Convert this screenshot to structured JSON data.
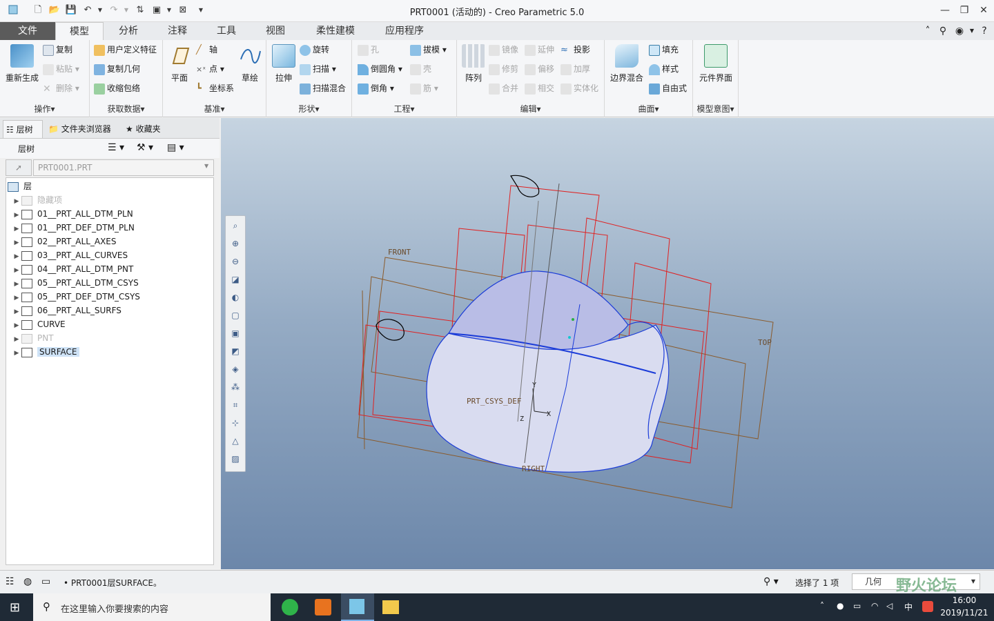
{
  "window": {
    "title": "PRT0001 (活动的) - Creo Parametric 5.0"
  },
  "tabs": [
    "文件",
    "模型",
    "分析",
    "注释",
    "工具",
    "视图",
    "柔性建模",
    "应用程序"
  ],
  "ribbon": {
    "operations": {
      "regen": "重新生成",
      "copy": "复制",
      "paste": "粘贴",
      "delete": "删除",
      "label": "操作▾"
    },
    "get_data": {
      "udf": "用户定义特征",
      "copy_geom": "复制几何",
      "shrinkwrap": "收缩包络",
      "label": "获取数据▾"
    },
    "datum": {
      "plane": "平面",
      "axis": "轴",
      "point": "点",
      "csys": "坐标系",
      "sketch": "草绘",
      "label": "基准▾"
    },
    "shapes": {
      "extrude": "拉伸",
      "revolve": "旋转",
      "sweep": "扫描",
      "swept_blend": "扫描混合",
      "label": "形状▾"
    },
    "engineering": {
      "hole": "孔",
      "round": "倒圆角",
      "chamfer": "倒角",
      "draft": "拔模",
      "shell": "壳",
      "rib": "筋",
      "label": "工程▾"
    },
    "editing": {
      "pattern": "阵列",
      "mirror": "镜像",
      "extend": "延伸",
      "project": "投影",
      "trim": "修剪",
      "offset": "偏移",
      "thicken": "加厚",
      "merge": "合并",
      "intersect": "相交",
      "solidify": "实体化",
      "label": "编辑▾"
    },
    "surfaces": {
      "boundary_blend": "边界混合",
      "fill": "填充",
      "style": "样式",
      "freestyle": "自由式",
      "label": "曲面▾"
    },
    "intent": {
      "component_interface": "元件界面",
      "label": "模型意图▾"
    }
  },
  "left_panel": {
    "tabs": [
      "层树",
      "文件夹浏览器",
      "收藏夹"
    ],
    "header": "层树",
    "combo_value": "PRT0001.PRT",
    "root": "层",
    "layers": [
      {
        "name": "隐藏项",
        "disabled": true
      },
      {
        "name": "01__PRT_ALL_DTM_PLN",
        "disabled": false
      },
      {
        "name": "01__PRT_DEF_DTM_PLN",
        "disabled": false
      },
      {
        "name": "02__PRT_ALL_AXES",
        "disabled": false
      },
      {
        "name": "03__PRT_ALL_CURVES",
        "disabled": false
      },
      {
        "name": "04__PRT_ALL_DTM_PNT",
        "disabled": false
      },
      {
        "name": "05__PRT_ALL_DTM_CSYS",
        "disabled": false
      },
      {
        "name": "05__PRT_DEF_DTM_CSYS",
        "disabled": false
      },
      {
        "name": "06__PRT_ALL_SURFS",
        "disabled": false
      },
      {
        "name": "CURVE",
        "disabled": false
      },
      {
        "name": "PNT",
        "disabled": true
      },
      {
        "name": "SURFACE",
        "disabled": false,
        "selected": true
      }
    ]
  },
  "viewport": {
    "labels": {
      "front": "FRONT",
      "top": "TOP",
      "right": "RIGHT",
      "csys": "PRT_CSYS_DEF",
      "x": "X",
      "y": "Y",
      "z": "Z"
    }
  },
  "status": {
    "message": "• PRT0001层SURFACE。",
    "selection": "选择了 1 项",
    "filter": "几何",
    "watermark": "野火论坛"
  },
  "taskbar": {
    "search_placeholder": "在这里输入你要搜索的内容",
    "ime": "中",
    "time": "16:00",
    "date": "2019/11/21"
  }
}
